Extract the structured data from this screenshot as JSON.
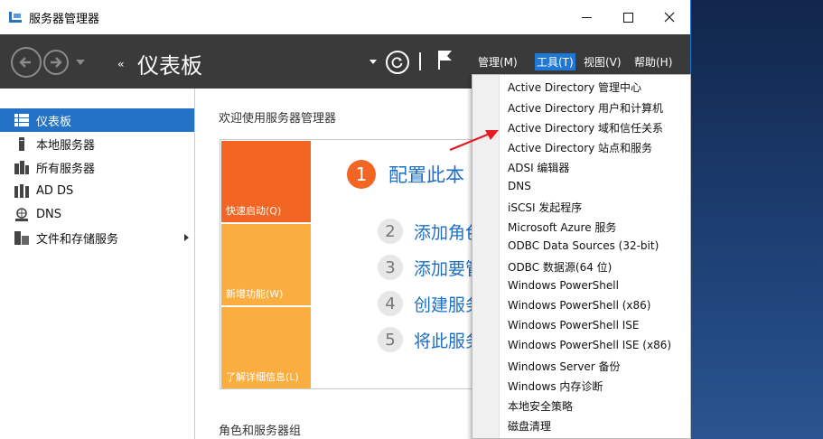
{
  "window": {
    "title": "服务器管理器"
  },
  "header": {
    "page_title": "仪表板",
    "crumb_arrows": "‹‹",
    "menus": {
      "manage": "管理(M)",
      "tools": "工具(T)",
      "view": "视图(V)",
      "help": "帮助(H)"
    }
  },
  "sidebar": {
    "items": [
      {
        "label": "仪表板",
        "icon": "dashboard-icon"
      },
      {
        "label": "本地服务器",
        "icon": "server-icon"
      },
      {
        "label": "所有服务器",
        "icon": "servers-icon"
      },
      {
        "label": "AD DS",
        "icon": "ad-ds-icon"
      },
      {
        "label": "DNS",
        "icon": "dns-icon"
      },
      {
        "label": "文件和存储服务",
        "icon": "file-storage-icon"
      }
    ]
  },
  "main": {
    "welcome_title": "欢迎使用服务器管理器",
    "tiles": [
      "快速启动(Q)",
      "新增功能(W)",
      "了解详细信息(L)"
    ],
    "step1": {
      "num": "1",
      "text": "配置此本"
    },
    "steps": [
      {
        "num": "2",
        "text": "添加角色"
      },
      {
        "num": "3",
        "text": "添加要管"
      },
      {
        "num": "4",
        "text": "创建服务"
      },
      {
        "num": "5",
        "text": "将此服务"
      }
    ],
    "roles_title": "角色和服务器组"
  },
  "tools_menu": {
    "items": [
      "Active Directory 管理中心",
      "Active Directory 用户和计算机",
      "Active Directory 域和信任关系",
      "Active Directory 站点和服务",
      "ADSI 编辑器",
      "DNS",
      "iSCSI 发起程序",
      "Microsoft Azure 服务",
      "ODBC Data Sources (32-bit)",
      "ODBC 数据源(64 位)",
      "Windows PowerShell",
      "Windows PowerShell (x86)",
      "Windows PowerShell ISE",
      "Windows PowerShell ISE (x86)",
      "Windows Server 备份",
      "Windows 内存诊断",
      "本地安全策略",
      "磁盘清理"
    ]
  },
  "colors": {
    "accent": "#2372c6",
    "header_bg": "#3a3a3a",
    "tile_orange": "#f26522",
    "tile_yellow": "#fbae40",
    "annotation_red": "#e31b23"
  }
}
